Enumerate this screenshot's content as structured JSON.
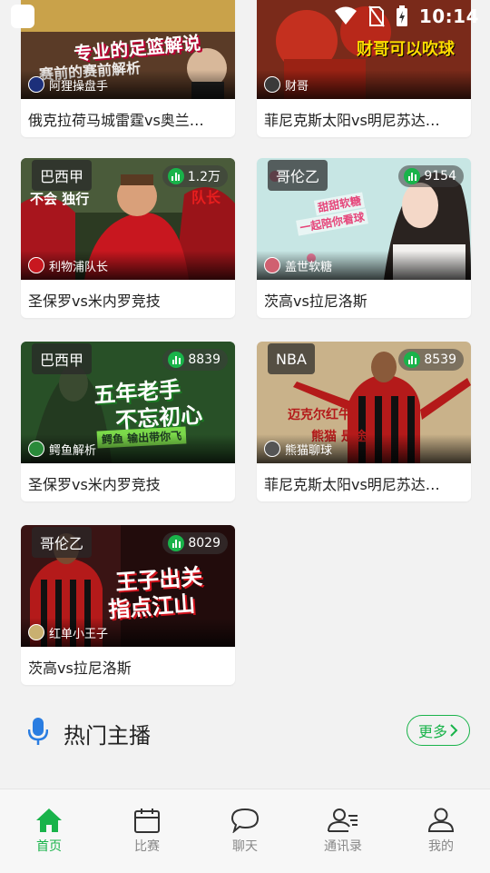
{
  "status_bar": {
    "time": "10:14"
  },
  "cards": [
    {
      "title": "俄克拉荷马城雷霆vs奥兰…",
      "host": "阿狸操盘手",
      "category": "",
      "viewers": "",
      "poster_text": [
        "专业的足篮解说",
        "赛前的赛前解析"
      ]
    },
    {
      "title": "菲尼克斯太阳vs明尼苏达…",
      "host": "财哥",
      "category": "",
      "viewers": "",
      "poster_text": [
        "财哥可以吹球"
      ]
    },
    {
      "title": "圣保罗vs米内罗竞技",
      "host": "利物浦队长",
      "category": "巴西甲",
      "viewers": "1.2万",
      "poster_text": [
        "不会 独行",
        "队长"
      ]
    },
    {
      "title": "茨高vs拉尼洛斯",
      "host": "盖世软糖",
      "category": "哥伦乙",
      "viewers": "9154",
      "poster_text": [
        "甜甜软糖",
        "一起陪你看球"
      ]
    },
    {
      "title": "圣保罗vs米内罗竞技",
      "host": "鳄鱼解析",
      "category": "巴西甲",
      "viewers": "8839",
      "poster_text": [
        "五年老手",
        "不忘初心",
        "鳄鱼 输出带你飞"
      ]
    },
    {
      "title": "菲尼克斯太阳vs明尼苏达…",
      "host": "熊猫聊球",
      "category": "NBA",
      "viewers": "8539",
      "poster_text": [
        "迈克尔红牛:",
        "熊猫 是途!"
      ]
    },
    {
      "title": "茨高vs拉尼洛斯",
      "host": "红单小王子",
      "category": "哥伦乙",
      "viewers": "8029",
      "poster_text": [
        "王子出关",
        "指点江山"
      ]
    }
  ],
  "hot_section": {
    "title": "热门主播",
    "more_label": "更多"
  },
  "bottom_nav": [
    {
      "label": "首页",
      "icon": "home-icon",
      "active": true
    },
    {
      "label": "比赛",
      "icon": "calendar-icon",
      "active": false
    },
    {
      "label": "聊天",
      "icon": "chat-icon",
      "active": false
    },
    {
      "label": "通讯录",
      "icon": "contacts-icon",
      "active": false
    },
    {
      "label": "我的",
      "icon": "profile-icon",
      "active": false
    }
  ],
  "colors": {
    "accent": "#19b34a",
    "background": "#f2f2f2"
  }
}
